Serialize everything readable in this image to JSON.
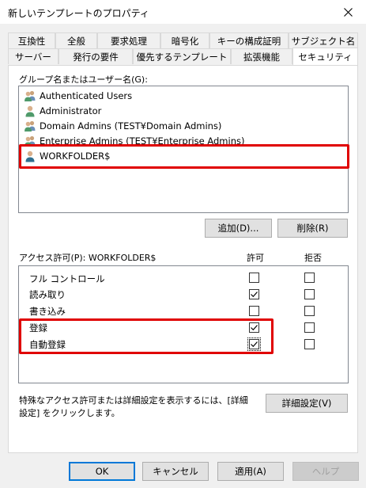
{
  "window": {
    "title": "新しいテンプレートのプロパティ"
  },
  "tabs_top": [
    {
      "label": "互換性"
    },
    {
      "label": "全般"
    },
    {
      "label": "要求処理"
    },
    {
      "label": "暗号化"
    },
    {
      "label": "キーの構成証明"
    },
    {
      "label": "サブジェクト名"
    }
  ],
  "tabs_bottom": [
    {
      "label": "サーバー"
    },
    {
      "label": "発行の要件"
    },
    {
      "label": "優先するテンプレート"
    },
    {
      "label": "拡張機能"
    },
    {
      "label": "セキュリティ",
      "active": true
    }
  ],
  "security": {
    "group_label": "グループ名またはユーザー名(G):",
    "users": [
      {
        "name": "Authenticated Users",
        "icon": "users-group-icon"
      },
      {
        "name": "Administrator",
        "icon": "user-icon"
      },
      {
        "name": "Domain Admins (TEST¥Domain Admins)",
        "icon": "users-group-icon"
      },
      {
        "name": "Enterprise Admins (TEST¥Enterprise Admins)",
        "icon": "users-group-icon"
      },
      {
        "name": "WORKFOLDER$",
        "icon": "user-icon",
        "selected": true
      }
    ],
    "add_button": "追加(D)...",
    "remove_button": "削除(R)",
    "permissions_label": "アクセス許可(P): WORKFOLDER$",
    "allow_header": "許可",
    "deny_header": "拒否",
    "permissions": [
      {
        "name": "フル コントロール",
        "allow": false,
        "deny": false
      },
      {
        "name": "読み取り",
        "allow": true,
        "deny": false
      },
      {
        "name": "書き込み",
        "allow": false,
        "deny": false
      },
      {
        "name": "登録",
        "allow": true,
        "deny": false
      },
      {
        "name": "自動登録",
        "allow": true,
        "deny": false,
        "focused": true
      }
    ],
    "advanced_text": "特殊なアクセス許可または詳細設定を表示するには、[詳細設定] をクリックします。",
    "advanced_button": "詳細設定(V)"
  },
  "footer": {
    "ok": "OK",
    "cancel": "キャンセル",
    "apply": "適用(A)",
    "help": "ヘルプ"
  },
  "colors": {
    "highlight": "#e00000",
    "accent": "#0078d7"
  }
}
